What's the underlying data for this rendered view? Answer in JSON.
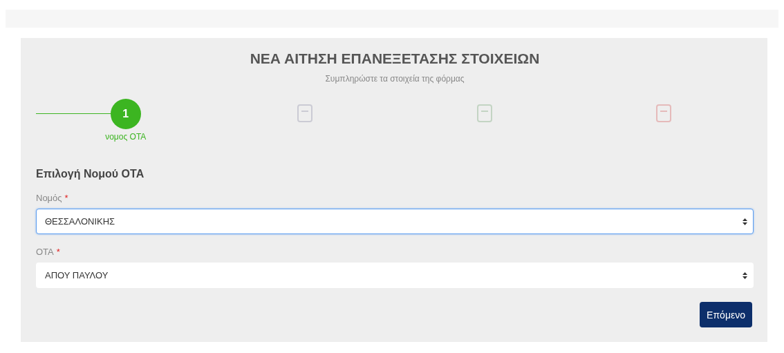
{
  "title": "ΝΕΑ ΑΙΤΗΣΗ ΕΠΑΝΕΞΕΤΑΣΗΣ ΣΤΟΙΧΕΙΩΝ",
  "subtitle": "Συμπληρώστε τα στοιχεία της φόρμας",
  "steps": [
    {
      "number": "1",
      "label": "νομος ΟΤΑ",
      "active": true
    },
    {
      "active": false
    },
    {
      "active": false
    },
    {
      "active": false
    }
  ],
  "section_title": "Επιλογή Νομού ΟΤΑ",
  "fields": [
    {
      "label": "Νομός",
      "required_mark": "*",
      "value": "ΘΕΣΣΑΛΟΝΙΚΗΣ",
      "focused": true
    },
    {
      "label": "ΟΤΑ",
      "required_mark": "*",
      "value": "ΑΠΟΥ ΠΑΥΛΟΥ",
      "focused": false
    }
  ],
  "next_button": "Επόμενο"
}
